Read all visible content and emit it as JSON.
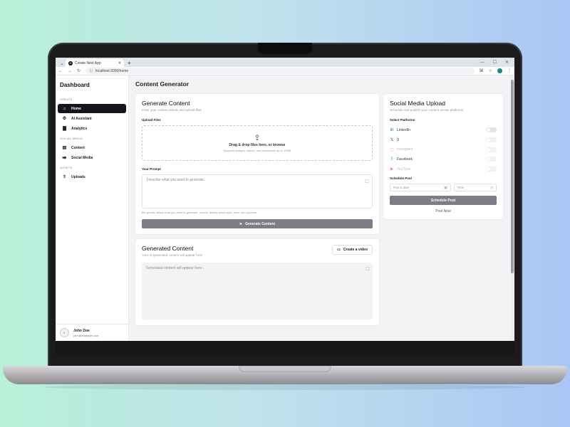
{
  "browser": {
    "tab_title": "Create Next App",
    "tab_favicon": "N",
    "new_tab": "+",
    "url": "localhost:3000/home",
    "window_controls": [
      "—",
      "☐",
      "✕"
    ]
  },
  "sidebar": {
    "title": "Dashboard",
    "sections": [
      {
        "label": "CREATE",
        "items": [
          {
            "label": "Home",
            "icon": "home-icon",
            "glyph": "⌂",
            "active": true
          },
          {
            "label": "AI Assistant",
            "icon": "robot-icon",
            "glyph": "⚙",
            "active": false
          },
          {
            "label": "Analytics",
            "icon": "chart-icon",
            "glyph": "▇",
            "active": false
          }
        ]
      },
      {
        "label": "SOCIAL MEDIA",
        "items": [
          {
            "label": "Content",
            "icon": "folder-icon",
            "glyph": "▤",
            "active": false
          },
          {
            "label": "Social Media",
            "icon": "share-icon",
            "glyph": "⮕",
            "active": false
          }
        ]
      },
      {
        "label": "ASSETS",
        "items": [
          {
            "label": "Uploads",
            "icon": "upload-icon",
            "glyph": "⇧",
            "active": false
          }
        ]
      }
    ],
    "user": {
      "name": "John Doe",
      "email": "john@example.com"
    }
  },
  "main": {
    "title": "Content Generator",
    "generate": {
      "title": "Generate Content",
      "subtitle": "Enter your content details and upload files",
      "upload_label": "Upload Files",
      "drop_title": "Drag & drop files here, or browse",
      "drop_hint": "Supports images, videos, and documents up to 10MB",
      "prompt_label": "Your Prompt",
      "prompt_placeholder": "Describe what you want to generate...",
      "prompt_hint": "Be specific about what you want to generate. Include details about style, tone, and purpose.",
      "button": "Generate Content"
    },
    "generated": {
      "title": "Generated Content",
      "subtitle": "Your AI-generated content will appear here",
      "video_button": "Create a video",
      "placeholder": "Generated content will appear here..."
    }
  },
  "social": {
    "title": "Social Media Upload",
    "subtitle": "Schedule and publish your content across platforms",
    "platforms_label": "Select Platforms",
    "platforms": [
      {
        "name": "LinkedIn",
        "icon": "linkedin-icon",
        "glyph": "in",
        "color": "#0a66c2",
        "dim": false
      },
      {
        "name": "X",
        "icon": "x-icon",
        "glyph": "𝕏",
        "color": "#333333",
        "dim": false
      },
      {
        "name": "Instagram",
        "icon": "instagram-icon",
        "glyph": "▢",
        "color": "#e1306c",
        "dim": true
      },
      {
        "name": "Facebook",
        "icon": "facebook-icon",
        "glyph": "f",
        "color": "#1877f2",
        "dim": false
      },
      {
        "name": "YouTube",
        "icon": "youtube-icon",
        "glyph": "▶",
        "color": "#ff0000",
        "dim": true
      }
    ],
    "schedule_label": "Schedule Post",
    "date_placeholder": "Pick a date",
    "time_placeholder": "Time",
    "schedule_button": "Schedule Post",
    "post_now": "Post Now"
  }
}
